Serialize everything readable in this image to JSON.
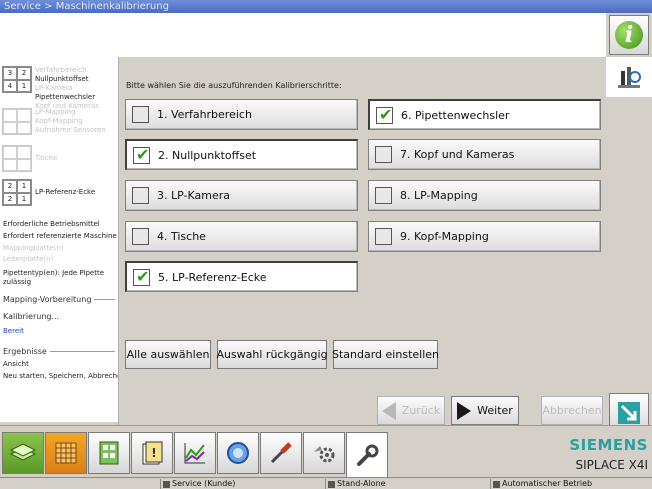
{
  "window": {
    "title": "Service > Maschinenkalibrierung"
  },
  "left_panel": {
    "groups": [
      {
        "grid": [
          "3",
          "2",
          "4",
          "1"
        ],
        "dim": false,
        "lines": [
          {
            "text": "Verfahrbereich",
            "dim": true
          },
          {
            "text": "Nullpunktoffset",
            "dim": false
          },
          {
            "text": "LP-Kamera",
            "dim": true
          },
          {
            "text": "Pipettenwechsler",
            "dim": false
          },
          {
            "text": "Kopf und Kameras",
            "dim": true
          }
        ]
      },
      {
        "grid": [
          "",
          "",
          "",
          ""
        ],
        "dim": true,
        "lines": [
          {
            "text": "LP-Mapping",
            "dim": true
          },
          {
            "text": "Kopf-Mapping",
            "dim": true
          },
          {
            "text": "Aufnahme Sensoren",
            "dim": true
          }
        ]
      },
      {
        "grid": [
          "",
          "",
          "",
          ""
        ],
        "dim": true,
        "lines": [
          {
            "text": "Tische",
            "dim": true
          }
        ]
      },
      {
        "grid": [
          "2",
          "1",
          "2",
          "1"
        ],
        "dim": false,
        "lines": [
          {
            "text": "LP-Referenz-Ecke",
            "dim": false
          }
        ]
      }
    ],
    "required_resources_title": "Erforderliche Betriebsmittel",
    "required_machine": "Erfordert referenzierte Maschine",
    "mapping_plate": "Mappingplatte(n)",
    "calibration_cards": "Leiterplatte(n)",
    "pipette_type": "Pipettentyp(en): Jede Pipette zulässig",
    "section_mapping": "Mapping-Vorbereitung",
    "section_calibration": "Kalibrierung...",
    "status_ready": "Bereit",
    "section_results": "Ergebnisse",
    "result_view": "Ansicht",
    "result_actions": "Neu starten, Speichern, Abbrechen"
  },
  "main": {
    "prompt": "Bitte wählen Sie die auszuführenden Kalibrierschritte:",
    "steps": [
      {
        "label": "1. Verfahrbereich",
        "checked": false
      },
      {
        "label": "2. Nullpunktoffset",
        "checked": true
      },
      {
        "label": "3. LP-Kamera",
        "checked": false
      },
      {
        "label": "4. Tische",
        "checked": false
      },
      {
        "label": "5. LP-Referenz-Ecke",
        "checked": true
      },
      {
        "label": "6. Pipettenwechsler",
        "checked": true
      },
      {
        "label": "7. Kopf und Kameras",
        "checked": false
      },
      {
        "label": "8. LP-Mapping",
        "checked": false
      },
      {
        "label": "9. Kopf-Mapping",
        "checked": false
      }
    ],
    "buttons": {
      "select_all": "Alle auswählen",
      "undo_selection": "Auswahl rückgängig",
      "set_default": "Standard einstellen",
      "back": "Zurück",
      "next": "Weiter",
      "cancel": "Abbrechen"
    }
  },
  "sidebar_right": {
    "icons": [
      "info-icon",
      "calibration-tool-icon",
      "exit-arrow-icon"
    ]
  },
  "brand": {
    "name": "SIEMENS",
    "product": "SIPLACE X4I"
  },
  "status_bar": {
    "service_mode": "Service (Kunde)",
    "line_mode": "Stand-Alone",
    "operation_mode": "Automatischer Betrieb"
  },
  "colors": {
    "accent_green": "#2a9c18",
    "siemens_teal": "#2c9fa0",
    "title_blue": "#4a6cc0"
  }
}
